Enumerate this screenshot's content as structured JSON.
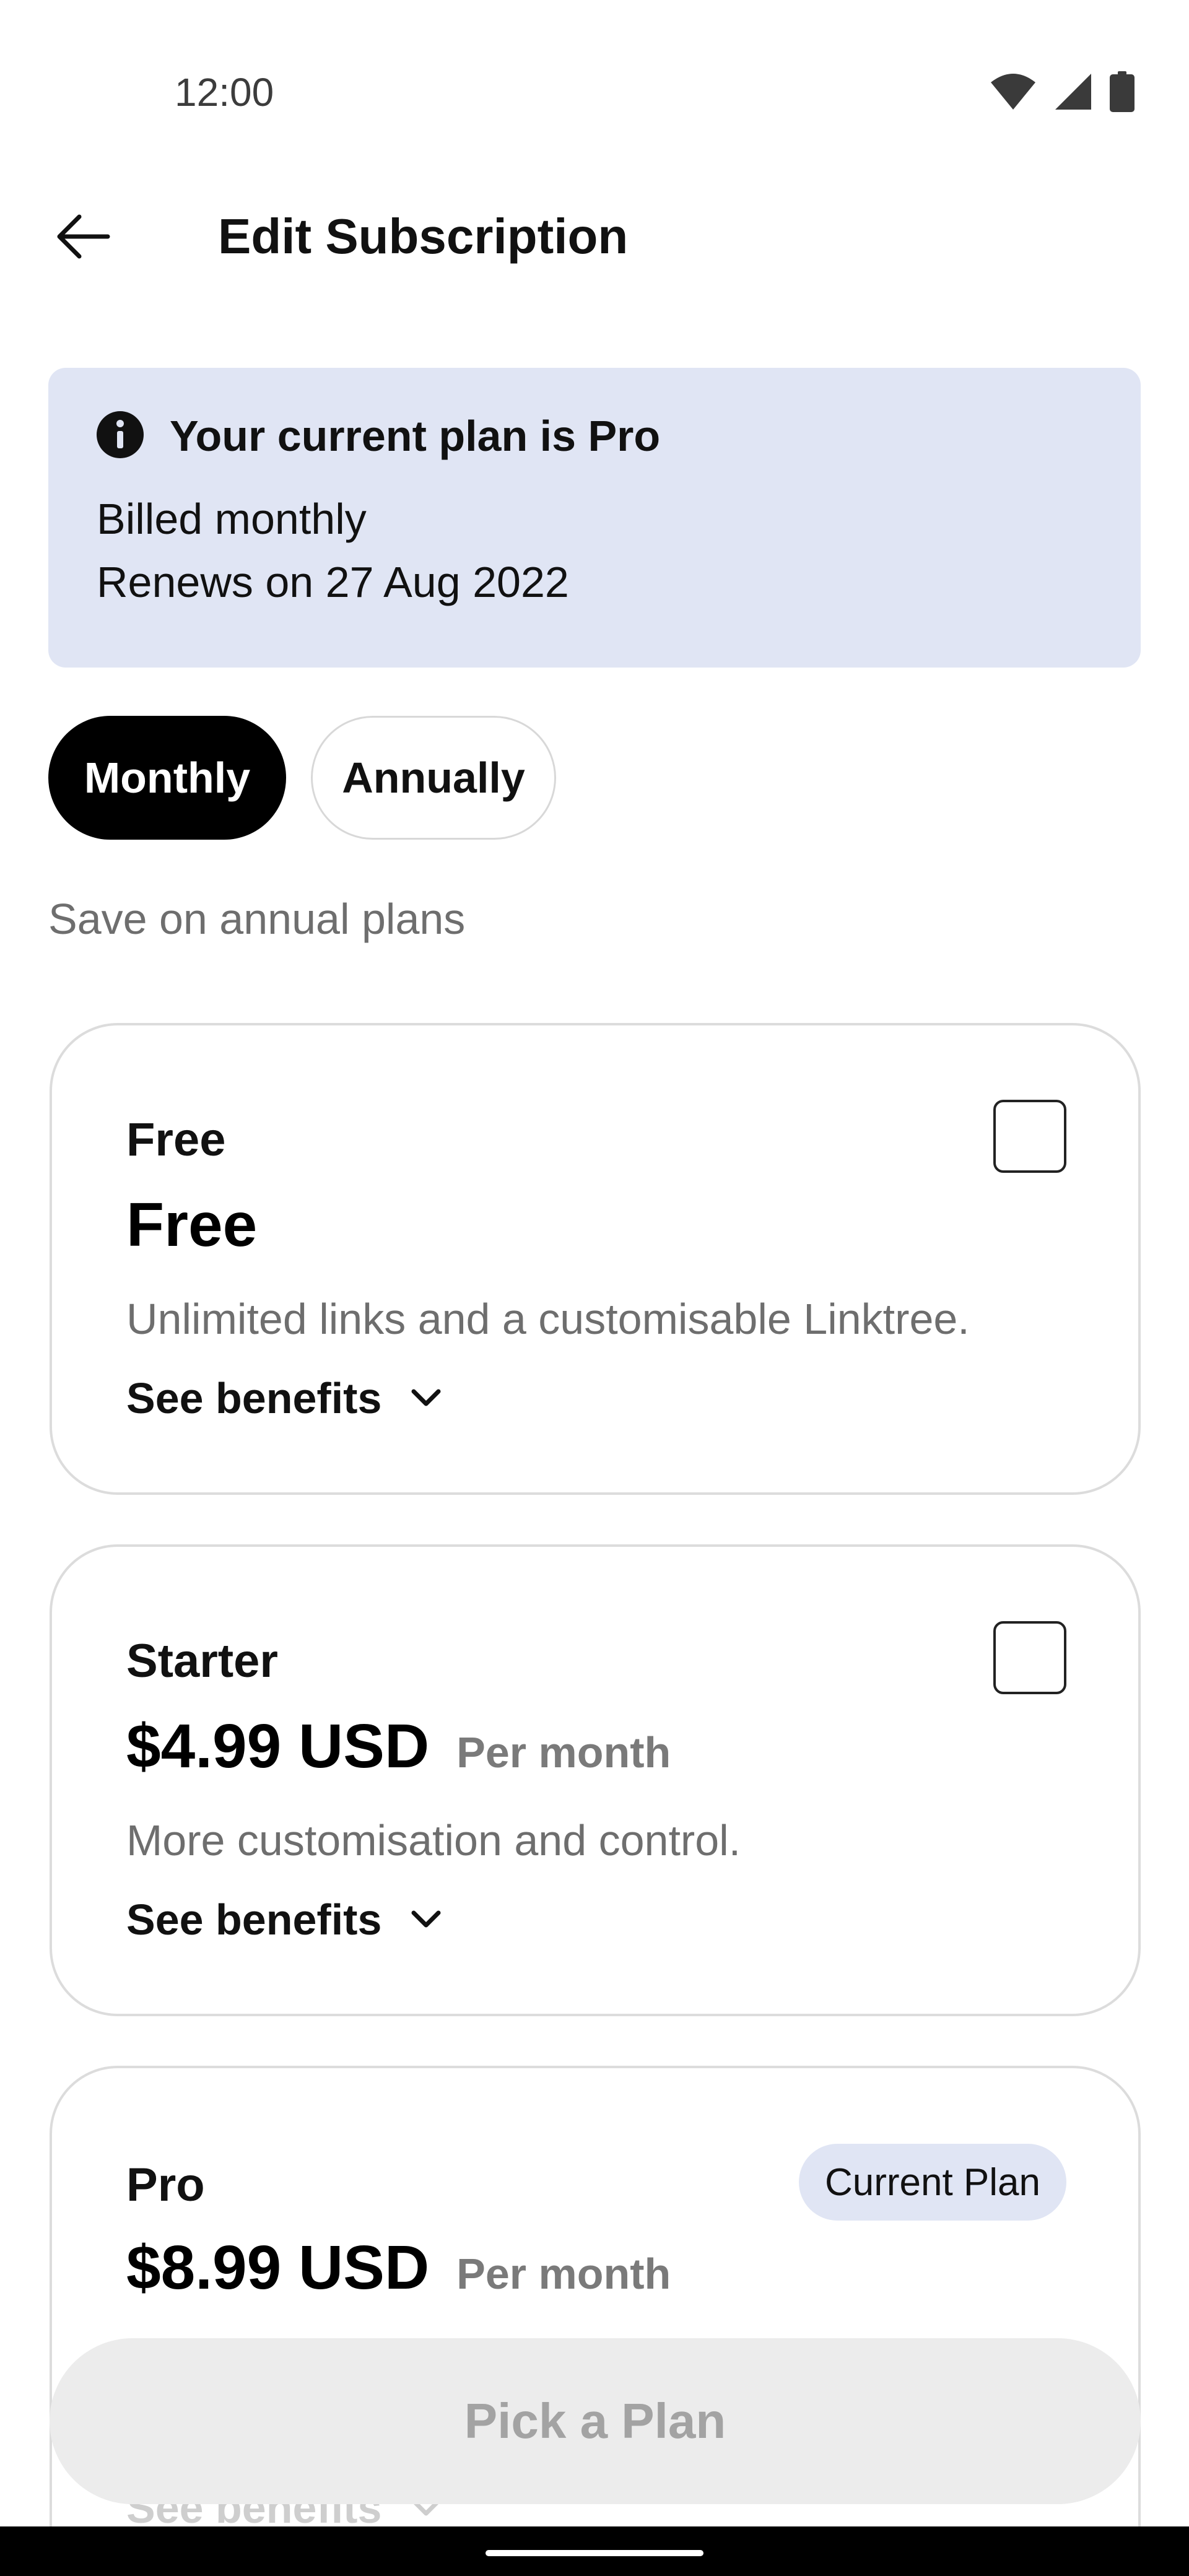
{
  "status_bar": {
    "time": "12:00",
    "icons": [
      "wifi-icon",
      "signal-icon",
      "battery-icon"
    ]
  },
  "app_bar": {
    "back_icon": "arrow-left-icon",
    "title": "Edit Subscription"
  },
  "current_plan_banner": {
    "icon": "info-icon",
    "title": "Your current plan is Pro",
    "billing": "Billed monthly",
    "renewal": "Renews on 27 Aug 2022",
    "background_color": "#e0e5f4"
  },
  "billing_toggle": {
    "options": [
      "Monthly",
      "Annually"
    ],
    "selected": "Monthly",
    "note": "Save on annual plans"
  },
  "plans": [
    {
      "name": "Free",
      "price": "Free",
      "period": "",
      "description": "Unlimited links and a customisable Linktree.",
      "benefits_label": "See benefits",
      "selected": false,
      "is_current": false
    },
    {
      "name": "Starter",
      "price": "$4.99 USD",
      "period": "Per month",
      "description": "More customisation and control.",
      "benefits_label": "See benefits",
      "selected": false,
      "is_current": false
    },
    {
      "name": "Pro",
      "price": "$8.99 USD",
      "period": "Per month",
      "badge": "Current Plan",
      "benefits_label": "See benefits",
      "is_current": true
    }
  ],
  "cta": {
    "label": "Pick a Plan",
    "enabled": false
  },
  "colors": {
    "accent_dark": "#000000",
    "muted_text": "#6e6e6e",
    "badge_bg": "#e0e5f4",
    "disabled_button_bg": "#ececec"
  }
}
